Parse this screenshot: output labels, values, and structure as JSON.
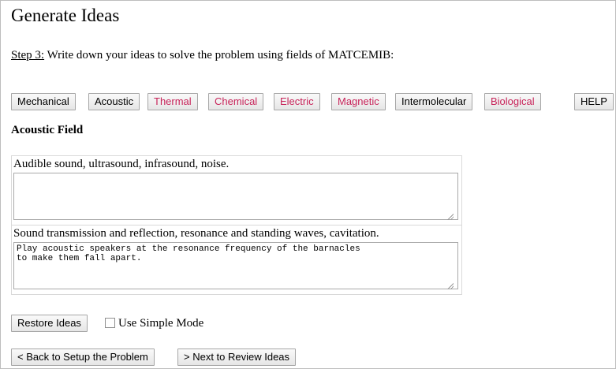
{
  "page": {
    "title": "Generate Ideas"
  },
  "step": {
    "label": "Step 3:",
    "text": " Write down your ideas to solve the problem using fields of MATCEMIB:"
  },
  "fields": [
    {
      "label": "Mechanical",
      "color": "#000000"
    },
    {
      "label": "Acoustic",
      "color": "#000000"
    },
    {
      "label": "Thermal",
      "color": "#c8245a"
    },
    {
      "label": "Chemical",
      "color": "#c8245a"
    },
    {
      "label": "Electric",
      "color": "#c8245a"
    },
    {
      "label": "Magnetic",
      "color": "#c8245a"
    },
    {
      "label": "Intermolecular",
      "color": "#000000"
    },
    {
      "label": "Biological",
      "color": "#c8245a"
    }
  ],
  "help_label": "HELP",
  "section": {
    "heading": "Acoustic Field",
    "subfields": [
      {
        "label": "Audible sound, ultrasound, infrasound, noise.",
        "value": ""
      },
      {
        "label": "Sound transmission and reflection, resonance and standing waves, cavitation.",
        "value": "Play acoustic speakers at the resonance frequency of the barnacles\nto make them fall apart."
      }
    ]
  },
  "controls": {
    "restore_label": "Restore Ideas",
    "simple_mode_label": "Use Simple Mode",
    "simple_mode_checked": false
  },
  "nav": {
    "back_label": "< Back to Setup the Problem",
    "next_label": "> Next to Review Ideas"
  }
}
